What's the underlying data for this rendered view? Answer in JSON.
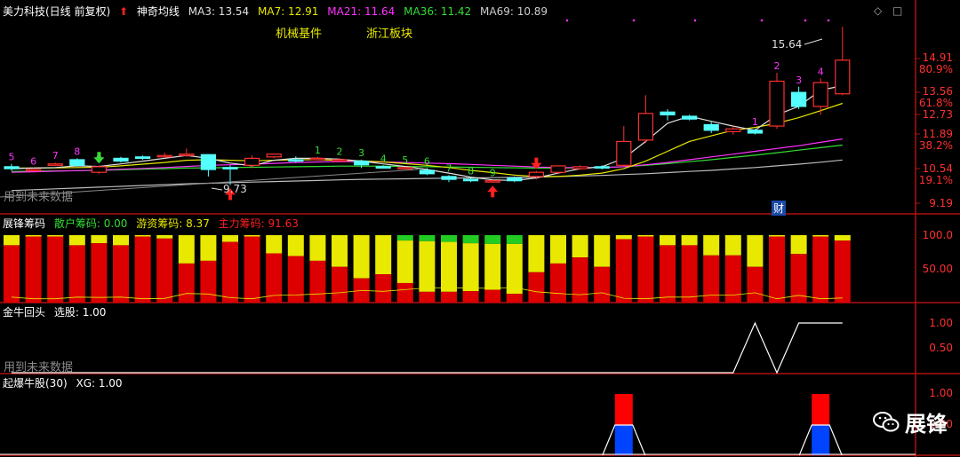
{
  "main": {
    "stock_name": "美力科技(日线 前复权)",
    "up_arrow": "⬆",
    "indicator_name": "神奇均线",
    "ma": [
      {
        "label": "MA3: 13.54",
        "color": "#e0e0e0"
      },
      {
        "label": "MA7: 12.91",
        "color": "#e8e800"
      },
      {
        "label": "MA21: 11.64",
        "color": "#ff33ff"
      },
      {
        "label": "MA36: 11.42",
        "color": "#33dd33"
      },
      {
        "label": "MA69: 10.89",
        "color": "#cccccc"
      }
    ],
    "sector1": "机械基件",
    "sector2": "浙江板块",
    "high_label": "15.64",
    "low_label": "9.73",
    "cai_label": "财",
    "future_note": "用到未来数据",
    "axis": [
      {
        "v": "14.91",
        "pct": "80.9%"
      },
      {
        "v": "13.56",
        "pct": "61.8%"
      },
      {
        "v": "12.73",
        "pct": ""
      },
      {
        "v": "11.89",
        "pct": "38.2%"
      },
      {
        "v": "10.54",
        "pct": "19.1%"
      },
      {
        "v": "9.19",
        "pct": ""
      }
    ],
    "controls": {
      "diamond": "◇",
      "square": "□"
    }
  },
  "chip": {
    "name": "展锋筹码",
    "retail": "散户筹码: 0.00",
    "hot": "游资筹码: 8.37",
    "main": "主力筹码: 91.63",
    "axis": [
      "100.0",
      "50.00"
    ]
  },
  "bull": {
    "name": "金牛回头",
    "value": "选股: 1.00",
    "axis": [
      "1.00",
      "0.50"
    ],
    "future_note": "用到未来数据"
  },
  "burst": {
    "name": "起爆牛股(30)",
    "value": "XG: 1.00",
    "axis": [
      "1.00",
      "0.50"
    ]
  },
  "watermark": "展锋",
  "chart_data": {
    "type": "candlestick",
    "candles": [
      {
        "o": 10.65,
        "c": 10.58,
        "h": 10.75,
        "l": 10.5
      },
      {
        "o": 10.55,
        "c": 10.55,
        "h": 10.6,
        "l": 10.5
      },
      {
        "o": 10.7,
        "c": 10.75,
        "h": 10.8,
        "l": 10.68
      },
      {
        "o": 10.9,
        "c": 10.7,
        "h": 10.95,
        "l": 10.65
      },
      {
        "o": 10.45,
        "c": 10.65,
        "h": 10.7,
        "l": 10.4
      },
      {
        "o": 10.95,
        "c": 10.85,
        "h": 11.0,
        "l": 10.8
      },
      {
        "o": 11.0,
        "c": 10.95,
        "h": 11.05,
        "l": 10.9
      },
      {
        "o": 11.05,
        "c": 11.05,
        "h": 11.15,
        "l": 11.0
      },
      {
        "o": 11.05,
        "c": 11.1,
        "h": 11.3,
        "l": 11.0
      },
      {
        "o": 11.08,
        "c": 10.55,
        "h": 11.1,
        "l": 10.3
      },
      {
        "o": 10.62,
        "c": 10.58,
        "h": 10.7,
        "l": 10.0
      },
      {
        "o": 10.7,
        "c": 10.95,
        "h": 11.05,
        "l": 10.6
      },
      {
        "o": 11.0,
        "c": 11.1,
        "h": 11.12,
        "l": 10.95
      },
      {
        "o": 10.9,
        "c": 10.85,
        "h": 11.02,
        "l": 10.8
      },
      {
        "o": 10.95,
        "c": 10.95,
        "h": 11.0,
        "l": 10.9
      },
      {
        "o": 10.9,
        "c": 10.9,
        "h": 10.95,
        "l": 10.85
      },
      {
        "o": 10.85,
        "c": 10.72,
        "h": 10.9,
        "l": 10.6
      },
      {
        "o": 10.65,
        "c": 10.62,
        "h": 10.7,
        "l": 10.6
      },
      {
        "o": 10.6,
        "c": 10.62,
        "h": 10.65,
        "l": 10.55
      },
      {
        "o": 10.52,
        "c": 10.4,
        "h": 10.6,
        "l": 10.35
      },
      {
        "o": 10.3,
        "c": 10.2,
        "h": 10.35,
        "l": 10.1
      },
      {
        "o": 10.2,
        "c": 10.15,
        "h": 10.25,
        "l": 10.1
      },
      {
        "o": 10.15,
        "c": 10.15,
        "h": 10.18,
        "l": 10.1
      },
      {
        "o": 10.25,
        "c": 10.15,
        "h": 10.3,
        "l": 10.1
      },
      {
        "o": 10.3,
        "c": 10.45,
        "h": 10.5,
        "l": 10.2
      },
      {
        "o": 10.45,
        "c": 10.68,
        "h": 10.7,
        "l": 10.4
      },
      {
        "o": 10.58,
        "c": 10.65,
        "h": 10.7,
        "l": 10.55
      },
      {
        "o": 10.65,
        "c": 10.62,
        "h": 10.7,
        "l": 10.55
      },
      {
        "o": 10.7,
        "c": 11.55,
        "h": 12.1,
        "l": 10.65
      },
      {
        "o": 11.6,
        "c": 12.55,
        "h": 13.2,
        "l": 11.5
      },
      {
        "o": 12.6,
        "c": 12.5,
        "h": 12.7,
        "l": 12.3
      },
      {
        "o": 12.45,
        "c": 12.35,
        "h": 12.5,
        "l": 12.3
      },
      {
        "o": 12.15,
        "c": 11.95,
        "h": 12.25,
        "l": 11.85
      },
      {
        "o": 11.9,
        "c": 12.0,
        "h": 12.1,
        "l": 11.8
      },
      {
        "o": 11.95,
        "c": 11.85,
        "h": 12.0,
        "l": 11.8
      },
      {
        "o": 12.1,
        "c": 13.7,
        "h": 14.0,
        "l": 12.0
      },
      {
        "o": 13.3,
        "c": 12.8,
        "h": 13.5,
        "l": 12.7
      },
      {
        "o": 12.8,
        "c": 13.65,
        "h": 13.8,
        "l": 12.5
      },
      {
        "o": 13.25,
        "c": 14.45,
        "h": 15.64,
        "l": 13.2
      }
    ],
    "ma3": [
      10.58,
      10.6,
      10.62,
      10.68,
      10.66,
      10.75,
      10.85,
      10.95,
      11.05,
      10.95,
      10.78,
      10.68,
      10.88,
      10.95,
      10.95,
      10.92,
      10.85,
      10.75,
      10.66,
      10.55,
      10.42,
      10.28,
      10.18,
      10.16,
      10.25,
      10.42,
      10.58,
      10.65,
      10.95,
      11.55,
      12.2,
      12.45,
      12.27,
      12.1,
      11.95,
      12.5,
      12.8,
      13.38,
      13.54
    ],
    "ma7": [
      10.6,
      10.6,
      10.61,
      10.62,
      10.63,
      10.68,
      10.74,
      10.8,
      10.88,
      10.9,
      10.88,
      10.86,
      10.88,
      10.9,
      10.9,
      10.88,
      10.86,
      10.82,
      10.76,
      10.7,
      10.62,
      10.52,
      10.44,
      10.35,
      10.3,
      10.3,
      10.35,
      10.42,
      10.58,
      10.85,
      11.2,
      11.55,
      11.75,
      11.95,
      12.05,
      12.2,
      12.4,
      12.65,
      12.91
    ],
    "ma21": [
      10.45,
      10.47,
      10.49,
      10.51,
      10.53,
      10.56,
      10.59,
      10.62,
      10.66,
      10.7,
      10.72,
      10.74,
      10.77,
      10.8,
      10.82,
      10.83,
      10.83,
      10.82,
      10.8,
      10.78,
      10.76,
      10.73,
      10.7,
      10.67,
      10.64,
      10.62,
      10.62,
      10.62,
      10.65,
      10.72,
      10.8,
      10.9,
      11.0,
      11.1,
      11.2,
      11.3,
      11.4,
      11.52,
      11.64
    ],
    "ma36": [
      10.48,
      10.49,
      10.5,
      10.51,
      10.52,
      10.54,
      10.56,
      10.58,
      10.6,
      10.61,
      10.62,
      10.63,
      10.64,
      10.65,
      10.66,
      10.67,
      10.67,
      10.67,
      10.66,
      10.65,
      10.64,
      10.63,
      10.62,
      10.61,
      10.6,
      10.6,
      10.61,
      10.62,
      10.65,
      10.7,
      10.76,
      10.83,
      10.9,
      10.98,
      11.06,
      11.15,
      11.24,
      11.33,
      11.42
    ],
    "ma69": [
      9.8,
      9.83,
      9.86,
      9.89,
      9.92,
      9.95,
      9.98,
      10.01,
      10.04,
      10.06,
      10.08,
      10.1,
      10.12,
      10.14,
      10.16,
      10.18,
      10.2,
      10.21,
      10.22,
      10.23,
      10.24,
      10.25,
      10.26,
      10.27,
      10.28,
      10.3,
      10.32,
      10.34,
      10.37,
      10.4,
      10.44,
      10.48,
      10.52,
      10.57,
      10.62,
      10.68,
      10.74,
      10.81,
      10.89
    ],
    "markers": [
      {
        "i": 0,
        "t": "5",
        "c": "#ff33ff"
      },
      {
        "i": 1,
        "t": "6",
        "c": "#ff33ff"
      },
      {
        "i": 2,
        "t": "7",
        "c": "#ff33ff"
      },
      {
        "i": 3,
        "t": "8",
        "c": "#ff33ff"
      },
      {
        "i": 4,
        "t": "9",
        "c": "#ff33ff"
      },
      {
        "i": 14,
        "t": "1",
        "c": "#33dd33"
      },
      {
        "i": 15,
        "t": "2",
        "c": "#33dd33"
      },
      {
        "i": 16,
        "t": "3",
        "c": "#33dd33"
      },
      {
        "i": 17,
        "t": "4",
        "c": "#33dd33"
      },
      {
        "i": 18,
        "t": "5",
        "c": "#33dd33"
      },
      {
        "i": 19,
        "t": "6",
        "c": "#33dd33"
      },
      {
        "i": 20,
        "t": "7",
        "c": "#33dd33"
      },
      {
        "i": 21,
        "t": "8",
        "c": "#33dd33"
      },
      {
        "i": 22,
        "t": "9",
        "c": "#33dd33"
      },
      {
        "i": 34,
        "t": "1",
        "c": "#ff33ff"
      },
      {
        "i": 35,
        "t": "2",
        "c": "#ff33ff"
      },
      {
        "i": 36,
        "t": "3",
        "c": "#ff33ff"
      },
      {
        "i": 37,
        "t": "4",
        "c": "#ff33ff"
      }
    ],
    "arrows": [
      {
        "i": 4,
        "dir": "down",
        "c": "#33dd33"
      },
      {
        "i": 10,
        "dir": "up",
        "c": "#ff2020"
      },
      {
        "i": 22,
        "dir": "up",
        "c": "#ff2020"
      },
      {
        "i": 24,
        "dir": "down",
        "c": "#ff2020"
      }
    ],
    "chips": [
      [
        0,
        15,
        85
      ],
      [
        0,
        2,
        98
      ],
      [
        0,
        2,
        98
      ],
      [
        0,
        15,
        85
      ],
      [
        0,
        12,
        88
      ],
      [
        0,
        15,
        85
      ],
      [
        0,
        2,
        98
      ],
      [
        0,
        5,
        95
      ],
      [
        0,
        42,
        58
      ],
      [
        0,
        38,
        62
      ],
      [
        0,
        10,
        90
      ],
      [
        0,
        2,
        98
      ],
      [
        0,
        27,
        73
      ],
      [
        0,
        31,
        69
      ],
      [
        0,
        38,
        62
      ],
      [
        0,
        47,
        53
      ],
      [
        0,
        64,
        36
      ],
      [
        0,
        58,
        42
      ],
      [
        8,
        63,
        29
      ],
      [
        9,
        75,
        16
      ],
      [
        10,
        74,
        16
      ],
      [
        12,
        71,
        17
      ],
      [
        13,
        68,
        19
      ],
      [
        13,
        74,
        13
      ],
      [
        0,
        55,
        45
      ],
      [
        0,
        42,
        58
      ],
      [
        0,
        33,
        67
      ],
      [
        0,
        47,
        53
      ],
      [
        0,
        6,
        94
      ],
      [
        0,
        2,
        98
      ],
      [
        0,
        15,
        85
      ],
      [
        0,
        15,
        85
      ],
      [
        0,
        30,
        70
      ],
      [
        0,
        30,
        70
      ],
      [
        0,
        47,
        53
      ],
      [
        0,
        2,
        98
      ],
      [
        0,
        28,
        72
      ],
      [
        0,
        2,
        98
      ],
      [
        0,
        8,
        92
      ]
    ],
    "bull_line": [
      0,
      0,
      0,
      0,
      0,
      0,
      0,
      0,
      0,
      0,
      0,
      0,
      0,
      0,
      0,
      0,
      0,
      0,
      0,
      0,
      0,
      0,
      0,
      0,
      0,
      0,
      0,
      0,
      0,
      0,
      0,
      0,
      0,
      0,
      1,
      0,
      1,
      1,
      1
    ],
    "burst_signals": [
      28,
      37
    ],
    "price_range": [
      9.0,
      15.9
    ]
  }
}
